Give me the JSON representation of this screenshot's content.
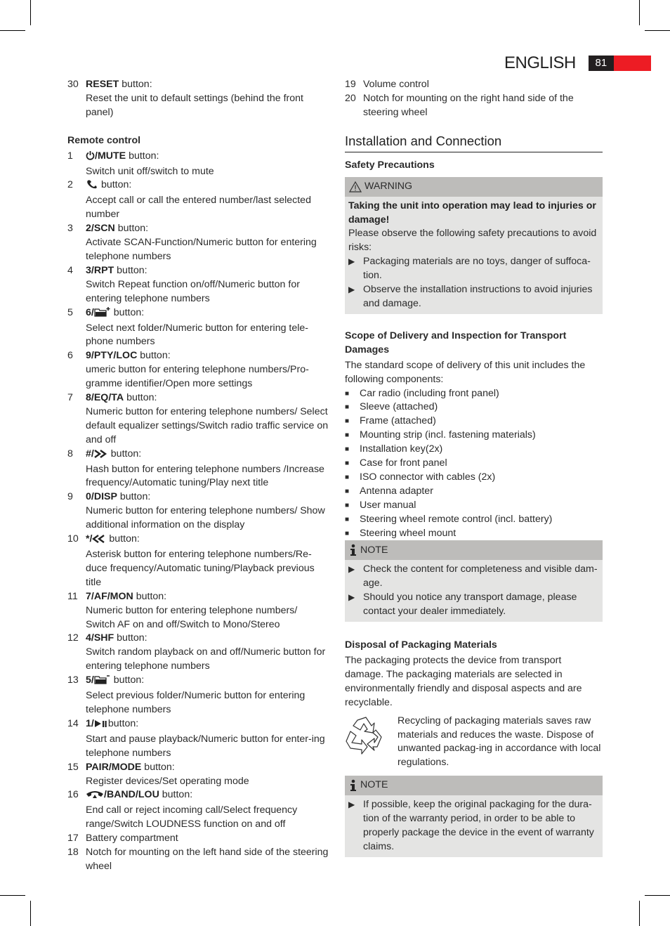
{
  "header": {
    "language": "ENGLISH",
    "page_number": "81",
    "accent_color": "#ed1c24"
  },
  "left": {
    "top_item": {
      "num": "30",
      "label": "RESET",
      "suffix": " button:",
      "desc": "Reset the unit to default settings (behind the front panel)"
    },
    "remote_heading": "Remote control",
    "items": [
      {
        "num": "1",
        "icon": "power-icon",
        "label": "/MUTE",
        "suffix": " button:",
        "desc": "Switch unit off/switch to mute"
      },
      {
        "num": "2",
        "icon": "phone-accept-icon",
        "label": "",
        "suffix": " button:",
        "desc": "Accept call or call the entered number/last selected number"
      },
      {
        "num": "3",
        "label": "2/SCN",
        "suffix": " button:",
        "desc": "Activate SCAN-Function/Numeric button for entering telephone numbers"
      },
      {
        "num": "4",
        "label": "3/RPT",
        "suffix": " button:",
        "desc": "Switch Repeat function on/off/Numeric button for entering telephone numbers"
      },
      {
        "num": "5",
        "label": "6/",
        "icon": "folder-plus-icon",
        "suffix": " button:",
        "desc": "Select next folder/Numeric button for entering tele-phone numbers"
      },
      {
        "num": "6",
        "label": "9/PTY/LOC",
        "suffix": " button:",
        "desc": "umeric button for entering telephone numbers/Pro-gramme identifier/Open more settings"
      },
      {
        "num": "7",
        "label": "8/EQ/TA",
        "suffix": " button:",
        "desc": "Numeric button for entering telephone numbers/ Select default equalizer settings/Switch radio traffic service on and off"
      },
      {
        "num": "8",
        "label": "#/",
        "icon": "next-icon",
        "suffix": " button:",
        "desc": "Hash button for entering telephone numbers /Increase frequency/Automatic tuning/Play next title"
      },
      {
        "num": "9",
        "label": "0/DISP",
        "suffix": " button:",
        "desc": "Numeric button for entering telephone numbers/ Show additional information on the display"
      },
      {
        "num": "10",
        "label": "*/",
        "icon": "previous-icon",
        "suffix": " button:",
        "desc": "Asterisk button for entering telephone numbers/Re-duce frequency/Automatic tuning/Playback previous title"
      },
      {
        "num": "11",
        "label": "7/AF/MON",
        "suffix": " button:",
        "desc": "Numeric button for entering telephone numbers/ Switch AF on and off/Switch to Mono/Stereo"
      },
      {
        "num": "12",
        "label": "4/SHF",
        "suffix": " button:",
        "desc": "Switch random playback on and off/Numeric button for entering telephone numbers"
      },
      {
        "num": "13",
        "label": "5/",
        "icon": "folder-minus-icon",
        "suffix": " button:",
        "desc": "Select previous folder/Numeric button for entering telephone numbers"
      },
      {
        "num": "14",
        "label": "1/",
        "icon": "play-pause-icon",
        "suffix": "button:",
        "desc": "Start and pause playback/Numeric button for enter-ing telephone numbers"
      },
      {
        "num": "15",
        "label": "PAIR/MODE",
        "suffix": " button:",
        "desc": "Register devices/Set operating mode"
      },
      {
        "num": "16",
        "icon": "phone-hangup-icon",
        "label": "/BAND/LOU",
        "suffix": " button:",
        "desc": "End call or reject incoming call/Select frequency range/Switch LOUDNESS function on and off"
      },
      {
        "num": "17",
        "label": "",
        "suffix": "",
        "desc": "Battery compartment"
      },
      {
        "num": "18",
        "label": "",
        "suffix": "",
        "desc": "Notch for mounting on the left hand side of the steering wheel"
      }
    ]
  },
  "right": {
    "items": [
      {
        "num": "19",
        "desc": "Volume control"
      },
      {
        "num": "20",
        "desc": "Notch for mounting on the right hand side of the steering wheel"
      }
    ],
    "section_title": "Installation and Connection",
    "safety_heading": "Safety Precautions",
    "warning": {
      "title": "WARNING",
      "bold": "Taking the unit into operation may lead to injuries or damage!",
      "text": "Please observe the following safety precautions to avoid risks:",
      "bullets": [
        "Packaging materials are no toys, danger of suffoca-tion.",
        "Observe the installation instructions to avoid injuries and damage."
      ]
    },
    "scope_heading": "Scope of Delivery and Inspection for Transport Damages",
    "scope_intro": "The standard scope of delivery of this unit includes the following components:",
    "scope_items": [
      "Car radio (including front panel)",
      "Sleeve (attached)",
      "Frame (attached)",
      "Mounting strip (incl. fastening materials)",
      "Installation key(2x)",
      "Case for front panel",
      "ISO connector with cables (2x)",
      "Antenna adapter",
      "User manual",
      "Steering wheel remote control (incl. battery)",
      "Steering wheel mount"
    ],
    "note1": {
      "title": "NOTE",
      "bullets": [
        "Check the content for completeness and visible dam-age.",
        "Should you notice any transport damage, please contact your dealer immediately."
      ]
    },
    "disposal_heading": "Disposal of Packaging Materials",
    "disposal_text": "The packaging protects the device from transport damage. The packaging materials are selected in environmentally friendly and disposal aspects and are recyclable.",
    "recycling_text": "Recycling of packaging materials saves raw materials and reduces the waste. Dispose of unwanted packag-ing in accordance with local regulations.",
    "note2": {
      "title": "NOTE",
      "bullets": [
        "If possible, keep the original packaging for the dura-tion of the warranty period, in order to be able to properly package the device in the event of warranty claims."
      ]
    }
  }
}
